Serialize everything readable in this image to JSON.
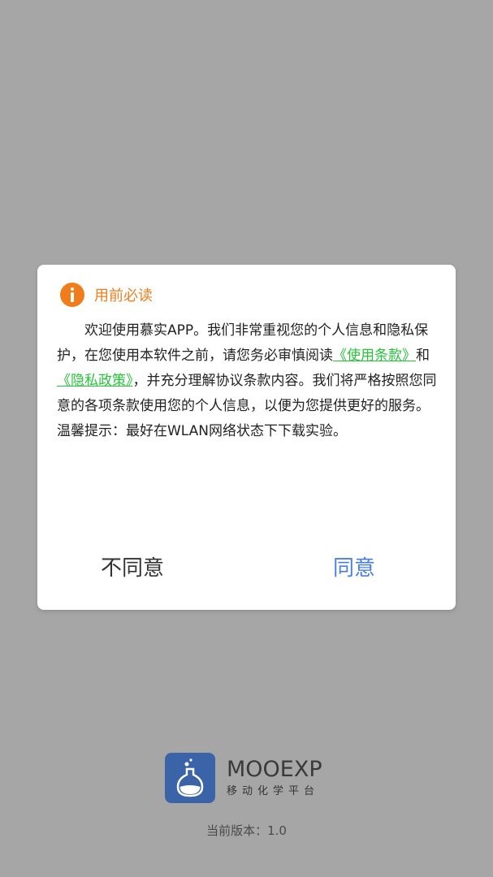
{
  "dialog": {
    "title": "用前必读",
    "body": {
      "line1_text": "欢迎使用慕实APP。我们非常重视您的个人信息和隐私保护，在您使用本软件之前，请您务必审慎阅读",
      "link_terms": "《使用条款》",
      "and": "和",
      "link_privacy": "《隐私政策》",
      "line1_rest": "，并充分理解协议条款内容。我们将严格按照您同意的各项条款使用您的个人信息，以便为您提供更好的服务。",
      "tip": "温馨提示：最好在WLAN网络状态下下载实验。"
    },
    "disagree_label": "不同意",
    "agree_label": "同意"
  },
  "brand": {
    "name": "MOOEXP",
    "subtitle": "移动化学平台",
    "logo_icon": "flask-icon"
  },
  "version_text": "当前版本：1.0",
  "colors": {
    "background": "#a6a6a6",
    "accent_orange": "#f07d1b",
    "link_green": "#27c43a",
    "agree_blue": "#4a7fe0",
    "logo_blue": "#3a63a8"
  }
}
